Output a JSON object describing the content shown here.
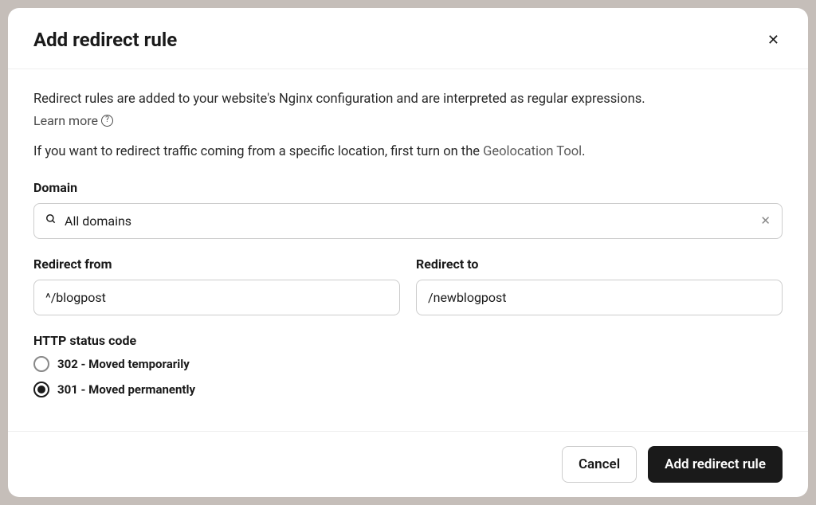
{
  "modal": {
    "title": "Add redirect rule",
    "description": "Redirect rules are added to your website's Nginx configuration and are interpreted as regular expressions.",
    "learn_more": "Learn more",
    "geolocation_prefix": "If you want to redirect traffic coming from a specific location, first turn on the ",
    "geolocation_link": "Geolocation Tool",
    "geolocation_suffix": "."
  },
  "domain": {
    "label": "Domain",
    "value": "All domains"
  },
  "redirect_from": {
    "label": "Redirect from",
    "value": "^/blogpost"
  },
  "redirect_to": {
    "label": "Redirect to",
    "value": "/newblogpost"
  },
  "status_code": {
    "label": "HTTP status code",
    "option_302": "302 - Moved temporarily",
    "option_301": "301 - Moved permanently",
    "selected": "301"
  },
  "footer": {
    "cancel": "Cancel",
    "submit": "Add redirect rule"
  }
}
